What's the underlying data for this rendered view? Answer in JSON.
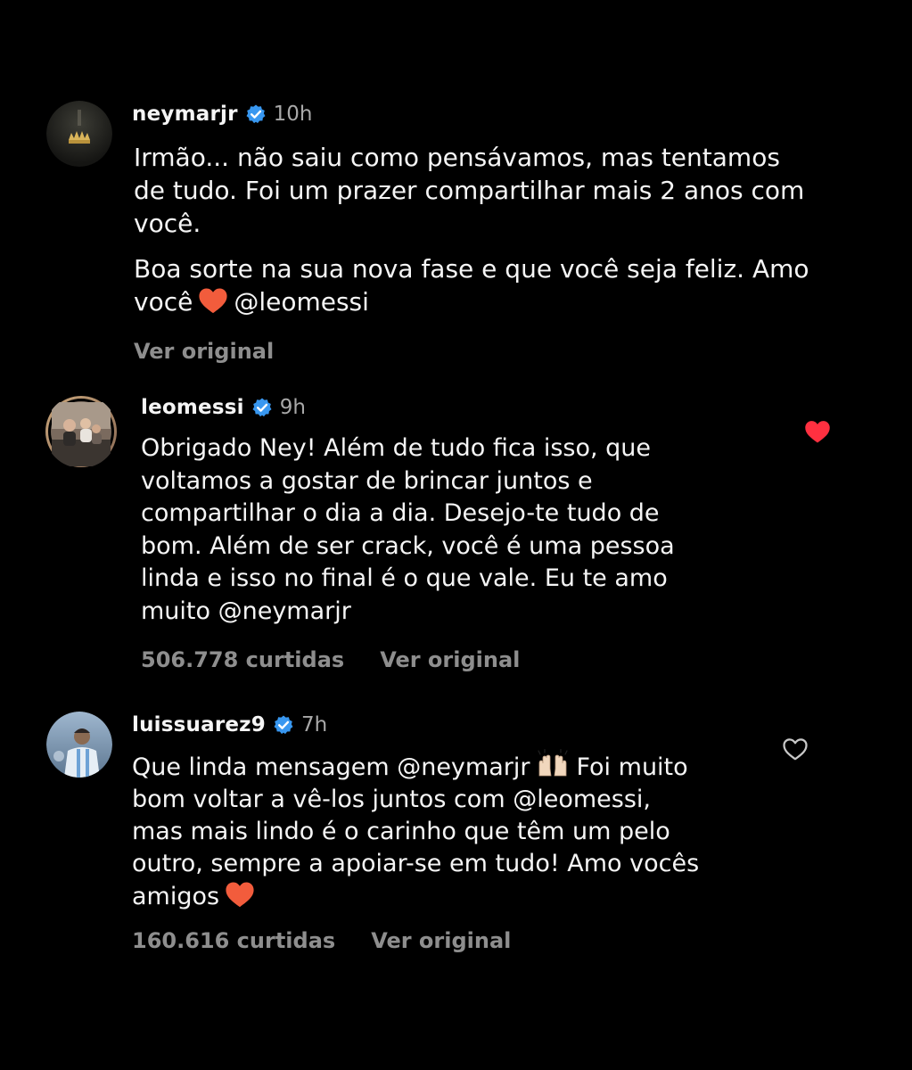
{
  "colors": {
    "background": "#000000",
    "text": "#f5f5f5",
    "secondary": "#8e8e8e",
    "verified_blue": "#3897f0",
    "like_red": "#ff3040",
    "heart_emoji": "#f25c3c"
  },
  "comments": [
    {
      "username": "neymarjr",
      "verified": true,
      "time": "10h",
      "paragraphs": [
        [
          "Irmão... não saiu como pensávamos, mas tentamos",
          "de tudo. Foi um prazer compartilhar mais 2 anos com",
          "você."
        ],
        [
          "Boa sorte na sua nova fase e que você seja feliz. Amo"
        ]
      ],
      "last_line_pre": "você",
      "last_line_emoji": "red-heart-emoji",
      "last_line_post": "@leomessi",
      "translate_label": "Ver original"
    },
    {
      "username": "leomessi",
      "verified": true,
      "time": "9h",
      "lines": [
        "Obrigado Ney! Além de tudo fica isso, que",
        "voltamos a gostar de brincar juntos e",
        "compartilhar o dia a dia. Desejo-te tudo de",
        "bom. Além de ser crack, você é uma pessoa",
        "linda e isso no final é o que vale. Eu te amo",
        "muito @neymarjr"
      ],
      "likes": "506.778 curtidas",
      "translate_label": "Ver original",
      "liked": true
    },
    {
      "username": "luissuarez9",
      "verified": true,
      "time": "7h",
      "line1_pre": "Que linda mensagem @neymarjr",
      "line1_emoji": "raising-hands-emoji",
      "line1_post": "Foi muito",
      "lines": [
        "bom voltar a vê-los juntos com @leomessi,",
        "mas mais lindo é o carinho que têm um pelo",
        "outro, sempre a apoiar-se em tudo! Amo vocês"
      ],
      "last_line_pre": "amigos",
      "last_line_emoji": "red-heart-emoji",
      "likes": "160.616 curtidas",
      "translate_label": "Ver original",
      "liked": false
    }
  ]
}
